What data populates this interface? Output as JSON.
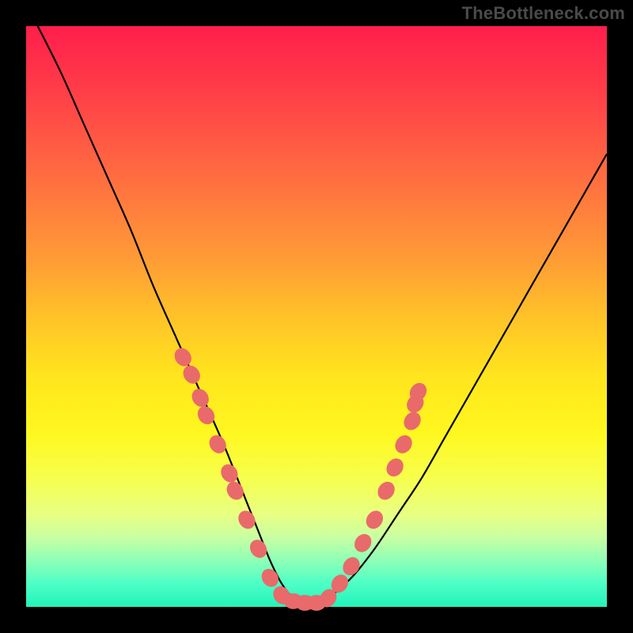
{
  "watermark": "TheBottleneck.com",
  "chart_data": {
    "type": "line",
    "title": "",
    "xlabel": "",
    "ylabel": "",
    "xlim": [
      0,
      100
    ],
    "ylim": [
      0,
      100
    ],
    "grid": false,
    "series": [
      {
        "name": "bottleneck-curve",
        "color": "#000000",
        "x": [
          2,
          6,
          10,
          14,
          18,
          22,
          26,
          30,
          34,
          38,
          40,
          42,
          44,
          46,
          48,
          50,
          52,
          56,
          60,
          64,
          68,
          72,
          76,
          80,
          84,
          88,
          92,
          96,
          100
        ],
        "y": [
          100,
          92,
          83,
          74,
          65,
          55,
          46,
          37,
          28,
          18,
          13,
          8,
          4,
          1.5,
          0.5,
          0.5,
          1.5,
          5,
          10,
          16,
          22,
          29,
          36,
          43,
          50,
          57,
          64,
          71,
          78
        ]
      }
    ],
    "markers": {
      "name": "data-points",
      "color": "#e96a6a",
      "radius_outer": 10,
      "radius_inner": 7,
      "points_xy": [
        [
          27,
          43
        ],
        [
          28.5,
          40
        ],
        [
          30,
          36
        ],
        [
          31,
          33
        ],
        [
          33,
          28
        ],
        [
          35,
          23
        ],
        [
          36,
          20
        ],
        [
          38,
          15
        ],
        [
          40,
          10
        ],
        [
          42,
          5
        ],
        [
          44,
          2
        ],
        [
          46,
          1
        ],
        [
          48,
          0.7
        ],
        [
          50,
          0.7
        ],
        [
          52,
          1.5
        ],
        [
          54,
          4
        ],
        [
          56,
          7
        ],
        [
          58,
          11
        ],
        [
          60,
          15
        ],
        [
          62,
          20
        ],
        [
          63.5,
          24
        ],
        [
          65,
          28
        ],
        [
          66.5,
          32
        ],
        [
          67,
          35
        ],
        [
          67.5,
          37
        ]
      ]
    }
  }
}
